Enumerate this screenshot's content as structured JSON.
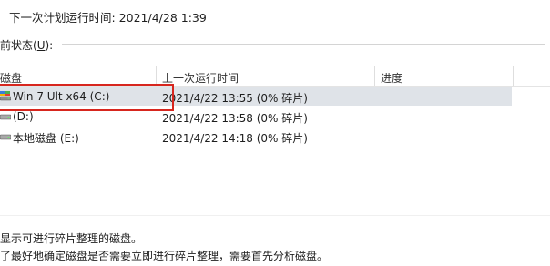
{
  "next_run": "下一次计划运行时间: 2021/4/28 1:39",
  "status": {
    "label": "前状态",
    "accesskey_prefix": "(",
    "accesskey": "U",
    "accesskey_suffix": "):"
  },
  "table": {
    "columns": [
      "磁盘",
      "上一次运行时间",
      "进度"
    ],
    "rows": [
      {
        "name": "Win 7 Ult x64 (C:)",
        "last_run": "2021/4/22 13:55 (0% 碎片)",
        "progress": "",
        "selected": true,
        "icon": "system-drive-icon"
      },
      {
        "name": "(D:)",
        "last_run": "2021/4/22 13:58 (0% 碎片)",
        "progress": "",
        "selected": false,
        "icon": "drive-icon"
      },
      {
        "name": "本地磁盘 (E:)",
        "last_run": "2021/4/22 14:18 (0% 碎片)",
        "progress": "",
        "selected": false,
        "icon": "drive-icon"
      }
    ]
  },
  "notes": [
    "显示可进行碎片整理的磁盘。",
    "了最好地确定磁盘是否需要立即进行碎片整理，需要首先分析磁盘。"
  ],
  "colors": {
    "highlight": "#d7261e",
    "selected_row": "#dfe3e8"
  }
}
